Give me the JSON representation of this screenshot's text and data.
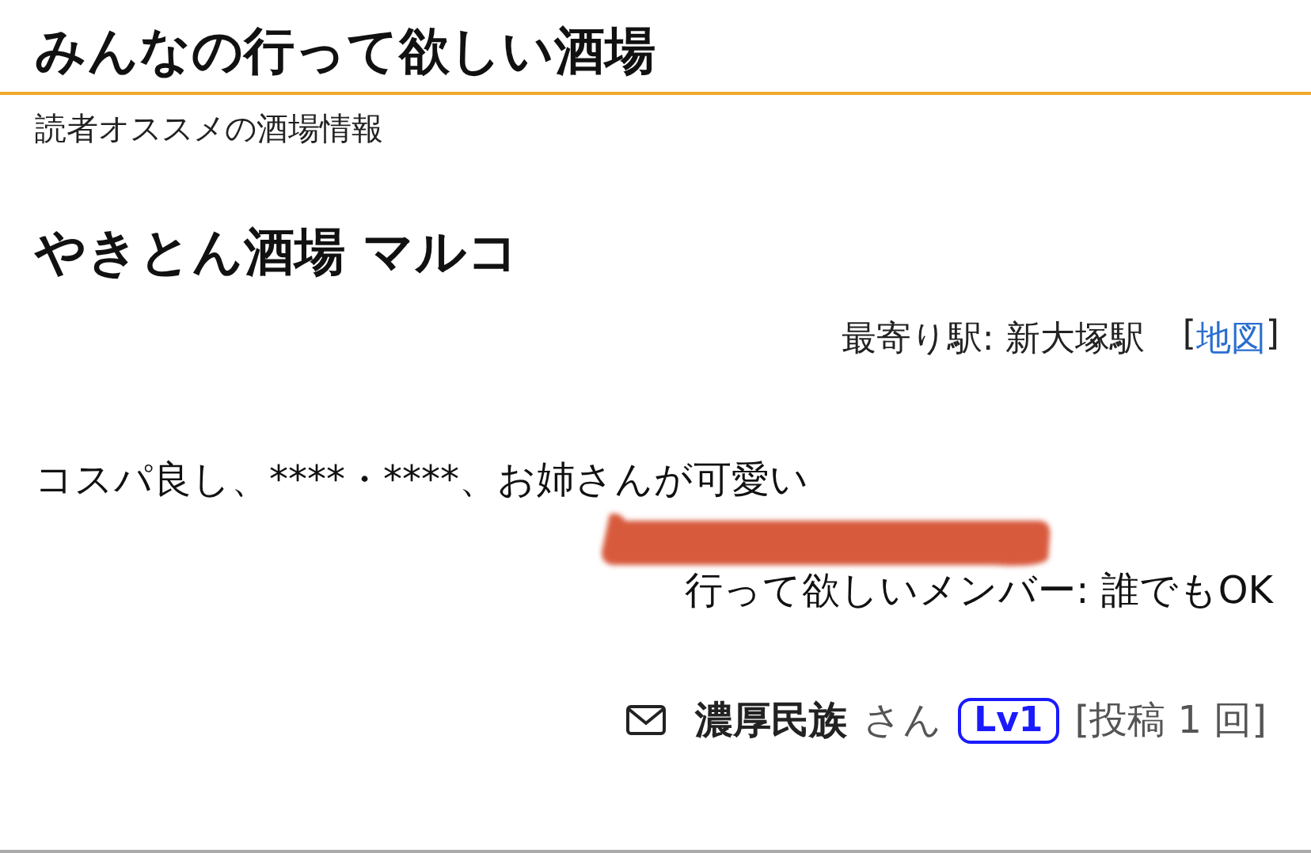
{
  "site": {
    "title": "みんなの行って欲しい酒場",
    "subtitle": "読者オススメの酒場情報"
  },
  "shop": {
    "name": "やきとん酒場 マルコ",
    "station": "最寄り駅: 新大塚駅",
    "map_open": "[",
    "map_link": "地図",
    "map_close": "]",
    "comment": "コスパ良し、****・****、お姉さんが可愛い",
    "members": "行って欲しいメンバー: 誰でもOK"
  },
  "poster": {
    "name": "濃厚民族",
    "honorific": "さん",
    "level": "Lv1",
    "post_count": "[投稿 1 回]"
  }
}
